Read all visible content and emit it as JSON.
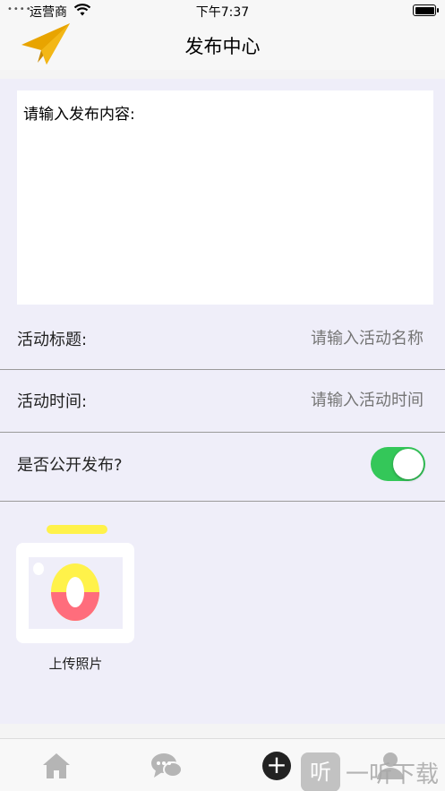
{
  "status_bar": {
    "carrier": "运营商",
    "time": "下午7:37"
  },
  "nav": {
    "title": "发布中心",
    "logo_icon": "paper-plane-icon"
  },
  "content_input": {
    "placeholder": "请输入发布内容:"
  },
  "form": {
    "title_label": "活动标题:",
    "title_placeholder": "请输入活动名称",
    "time_label": "活动时间:",
    "time_placeholder": "请输入活动时间",
    "public_label": "是否公开发布?",
    "public_enabled": true
  },
  "upload": {
    "label": "上传照片",
    "icon": "camera-icon"
  },
  "tab_bar": {
    "items": [
      {
        "icon": "home-icon"
      },
      {
        "icon": "chat-icon"
      },
      {
        "icon": "add-icon",
        "glyph": "+"
      },
      {
        "icon": "profile-icon"
      }
    ]
  },
  "watermark": {
    "badge": "听",
    "text": "一听下载"
  },
  "colors": {
    "accent_switch": "#34c759",
    "logo": "#e8a400",
    "background": "#efeef9"
  }
}
